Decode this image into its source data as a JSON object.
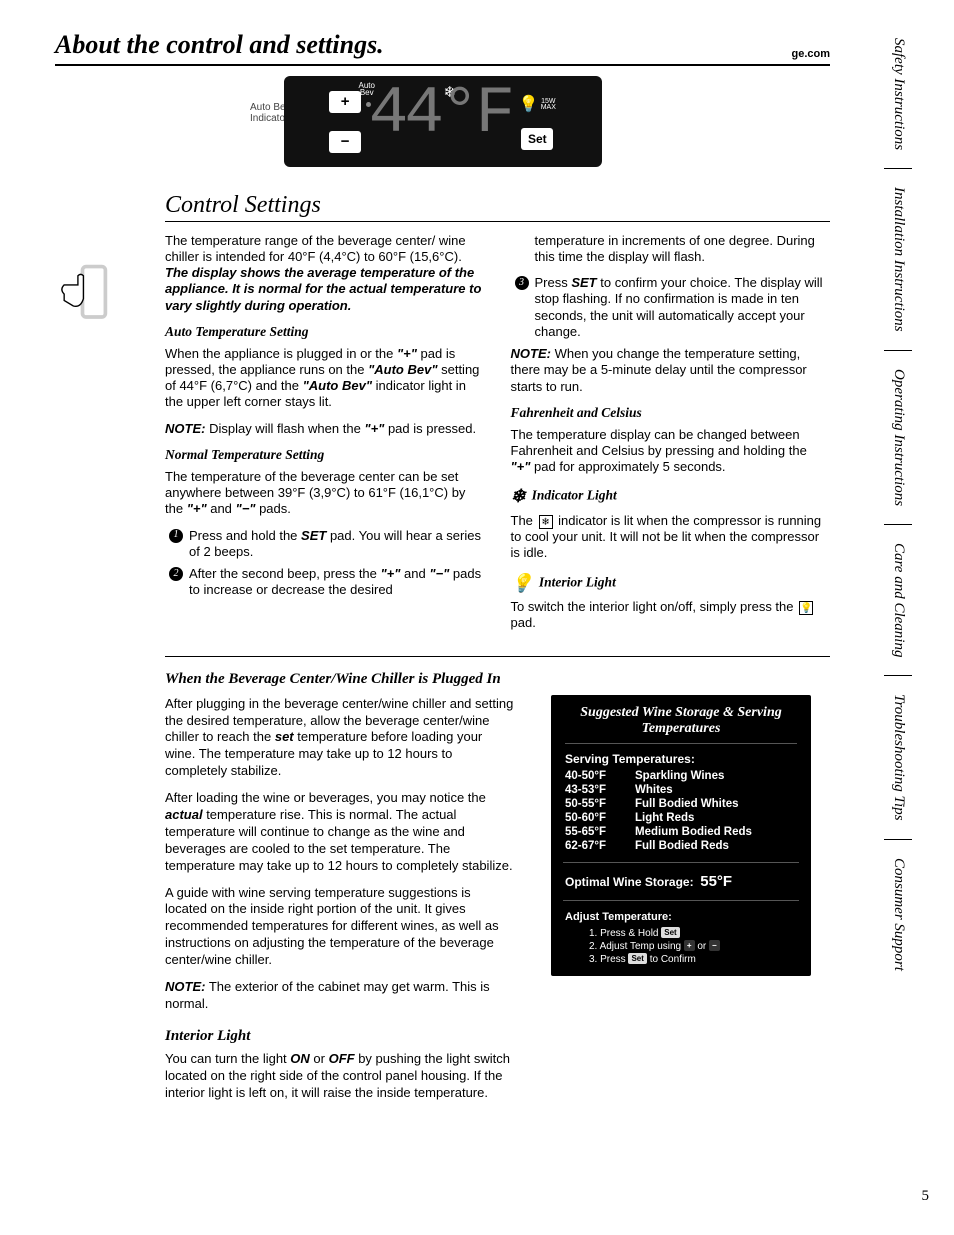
{
  "header": {
    "title": "About the control and settings.",
    "site": "ge.com"
  },
  "callout": "Auto Bev\nIndicator Light",
  "panel": {
    "auto_bev_label": "Auto\nBev",
    "temperature_display": "44°F",
    "light_max": "15W\nMAX",
    "plus": "+",
    "minus": "−",
    "set": "Set"
  },
  "section1": {
    "title": "Control Settings",
    "col1": {
      "intro_a": "The temperature range of the beverage center/ wine chiller is intended for 40°F (4,4°C) to 60°F (15,6°C). ",
      "intro_b": "The display shows the average temperature of the appliance. It is normal for the actual temperature to vary slightly during operation.",
      "h_auto": "Auto Temperature Setting",
      "auto_p1_a": "When the appliance is plugged in or the ",
      "auto_p1_b": " pad is pressed, the appliance runs on the ",
      "auto_p1_c": " setting of 44°F (6,7°C) and the ",
      "auto_p1_d": " indicator light in the upper left corner stays lit.",
      "q_plus": "\"+\"",
      "q_autobev": "\"Auto Bev\"",
      "auto_note_a": "NOTE:",
      "auto_note_b": " Display will flash when the ",
      "auto_note_c": " pad is pressed.",
      "h_normal": "Normal Temperature Setting",
      "normal_p1_a": "The temperature of the beverage center can be set anywhere between 39°F (3,9°C) to 61°F (16,1°C) by the ",
      "normal_p1_b": " and ",
      "normal_p1_c": " pads.",
      "q_minus": "\"−\"",
      "step1_a": "Press and hold the ",
      "step1_set": "SET",
      "step1_b": " pad. You will hear a series of 2 beeps.",
      "step2_a": "After the second beep, press the ",
      "step2_b": " and ",
      "step2_c": " pads to increase or decrease the desired"
    },
    "col2": {
      "cont": "temperature in increments of one degree. During this time the display will flash.",
      "step3_a": "Press ",
      "step3_set": "SET",
      "step3_b": " to confirm your choice. The display will stop flashing. If no confirmation is made in ten seconds, the unit will automatically accept your change.",
      "note_a": "NOTE:",
      "note_b": " When you change the temperature setting, there may be a 5-minute delay until the compressor starts to run.",
      "h_fc": "Fahrenheit and Celsius",
      "fc_p_a": "The temperature display can be changed between Fahrenheit and Celsius by pressing and holding the ",
      "fc_p_b": " pad for approximately 5 seconds.",
      "h_ind": "Indicator Light",
      "ind_p_a": "The ",
      "ind_p_b": " indicator is lit when the compressor is running to cool your unit. It will not be lit when the compressor is idle.",
      "h_int": "Interior Light",
      "int_p_a": "To switch the interior light on/off, simply press the ",
      "int_p_b": " pad."
    }
  },
  "section2": {
    "title": "When the Beverage Center/Wine Chiller is Plugged In",
    "p1_a": "After plugging in the beverage center/wine chiller and setting the desired temperature, allow the beverage center/wine chiller to reach the ",
    "p1_set": "set",
    "p1_b": " temperature before loading your wine. The temperature may take up to 12 hours to completely stabilize.",
    "p2_a": "After loading the wine or beverages, you may notice the ",
    "p2_act": "actual",
    "p2_b": " temperature rise. This is normal. The actual temperature will continue to change as the wine and beverages are cooled to the set temperature. The temperature may take up to 12 hours to completely stabilize.",
    "p3": "A guide with wine serving temperature suggestions is located on the inside right portion of the unit. It gives recommended temperatures for different wines, as well as instructions on adjusting the temperature of the beverage center/wine chiller.",
    "note_a": "NOTE:",
    "note_b": " The exterior of the cabinet may get warm. This is normal.",
    "h_int": "Interior Light",
    "int_p_a": "You can turn the light ",
    "int_on": "ON",
    "int_or": " or ",
    "int_off": "OFF",
    "int_p_b": " by pushing the light switch located on the right side of the control panel housing. If the interior light is left on, it will raise the inside temperature."
  },
  "wine": {
    "title": "Suggested Wine Storage & Serving Temperatures",
    "serving_h": "Serving Temperatures:",
    "rows": [
      {
        "t": "40-50°F",
        "n": "Sparkling Wines"
      },
      {
        "t": "43-53°F",
        "n": "Whites"
      },
      {
        "t": "50-55°F",
        "n": "Full Bodied Whites"
      },
      {
        "t": "50-60°F",
        "n": "Light Reds"
      },
      {
        "t": "55-65°F",
        "n": "Medium Bodied Reds"
      },
      {
        "t": "62-67°F",
        "n": "Full Bodied Reds"
      }
    ],
    "optimal_label": "Optimal Wine Storage:",
    "optimal_val": "55°F",
    "adjust_h": "Adjust Temperature:",
    "a1_a": "1. Press & Hold ",
    "a2_a": "2. Adjust Temp using ",
    "a2_or": " or ",
    "a3_a": "3. Press ",
    "a3_b": " to Confirm",
    "key_set": "Set",
    "key_plus": "+",
    "key_minus": "−"
  },
  "tabs": [
    "Safety Instructions",
    "Installation Instructions",
    "Operating Instructions",
    "Care and Cleaning",
    "Troubleshooting Tips",
    "Consumer Support"
  ],
  "page_number": "5"
}
